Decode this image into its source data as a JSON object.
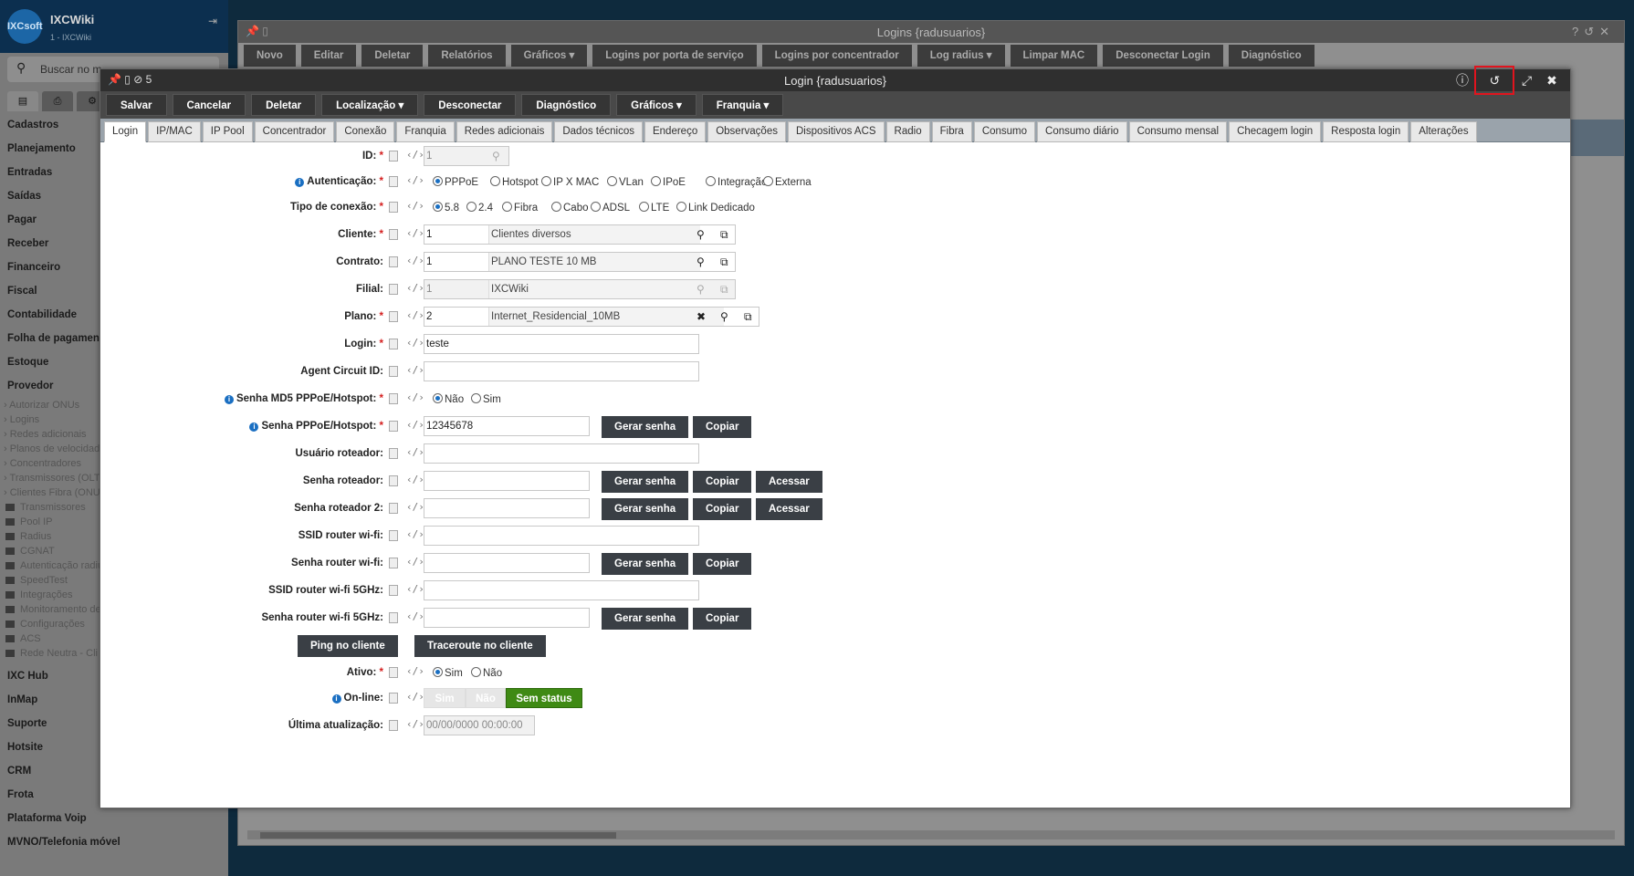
{
  "sidebar": {
    "logo": "IXCsoft",
    "app_name": "IXCWiki",
    "app_sub": "1 - IXCWiki",
    "search_placeholder": "Buscar no m",
    "menu_top": [
      "Cadastros",
      "Planejamento",
      "Entradas",
      "Saídas",
      "Pagar",
      "Receber",
      "Financeiro",
      "Fiscal",
      "Contabilidade",
      "Folha de pagamento",
      "Estoque",
      "Provedor"
    ],
    "submenu_arrows": [
      "Autorizar ONUs",
      "Logins",
      "Redes adicionais",
      "Planos de velocidade",
      "Concentradores",
      "Transmissores (OLT)",
      "Clientes Fibra (ONU)"
    ],
    "submenu_folders": [
      "Transmissores",
      "Pool IP",
      "Radius",
      "CGNAT",
      "Autenticação radius",
      "SpeedTest",
      "Integrações",
      "Monitoramento de",
      "Configurações",
      "ACS",
      "Rede Neutra - Cli"
    ],
    "menu_bottom": [
      "IXC Hub",
      "InMap",
      "Suporte",
      "Hotsite",
      "CRM",
      "Frota",
      "Plataforma Voip",
      "MVNO/Telefonia móvel"
    ]
  },
  "bgwin": {
    "title": "Logins {radusuarios}",
    "toolbar": [
      "Novo",
      "Editar",
      "Deletar",
      "Relatórios",
      "Gráficos ▾",
      "Logins por porta de serviço",
      "Logins por concentrador",
      "Log radius ▾",
      "Limpar MAC",
      "Desconectar Login",
      "Diagnóstico"
    ]
  },
  "modal": {
    "title": "Login {radusuarios}",
    "counter": "5",
    "toolbar": [
      "Salvar",
      "Cancelar",
      "Deletar",
      "Localização ▾",
      "Desconectar",
      "Diagnóstico",
      "Gráficos ▾",
      "Franquia ▾"
    ],
    "tabs": [
      "Login",
      "IP/MAC",
      "IP Pool",
      "Concentrador",
      "Conexão",
      "Franquia",
      "Redes adicionais",
      "Dados técnicos",
      "Endereço",
      "Observações",
      "Dispositivos ACS",
      "Radio",
      "Fibra",
      "Consumo",
      "Consumo diário",
      "Consumo mensal",
      "Checagem login",
      "Resposta login",
      "Alterações"
    ],
    "active_tab": "Login"
  },
  "form": {
    "id": {
      "label": "ID:",
      "value": "1"
    },
    "autenticacao": {
      "label": "Autenticação:",
      "options": [
        "PPPoE",
        "Hotspot",
        "IP X MAC",
        "VLan",
        "IPoE",
        "Integração",
        "Externa"
      ],
      "selected": "PPPoE"
    },
    "tipo_conexao": {
      "label": "Tipo de conexão:",
      "options": [
        "5.8",
        "2.4",
        "Fibra",
        "Cabo",
        "ADSL",
        "LTE",
        "Link Dedicado"
      ],
      "selected": "5.8"
    },
    "cliente": {
      "label": "Cliente:",
      "id": "1",
      "desc": "Clientes diversos"
    },
    "contrato": {
      "label": "Contrato:",
      "id": "1",
      "desc": "PLANO TESTE 10 MB"
    },
    "filial": {
      "label": "Filial:",
      "id": "1",
      "desc": "IXCWiki"
    },
    "plano": {
      "label": "Plano:",
      "id": "2",
      "desc": "Internet_Residencial_10MB"
    },
    "login": {
      "label": "Login:",
      "value": "teste"
    },
    "agent_circuit": {
      "label": "Agent Circuit ID:",
      "value": ""
    },
    "senha_md5": {
      "label": "Senha MD5 PPPoE/Hotspot:",
      "options": [
        "Não",
        "Sim"
      ],
      "selected": "Não"
    },
    "senha_pppoe": {
      "label": "Senha PPPoE/Hotspot:",
      "value": "12345678"
    },
    "usuario_roteador": {
      "label": "Usuário roteador:",
      "value": ""
    },
    "senha_roteador": {
      "label": "Senha roteador:",
      "value": ""
    },
    "senha_roteador2": {
      "label": "Senha roteador 2:",
      "value": ""
    },
    "ssid_wifi": {
      "label": "SSID router wi-fi:",
      "value": ""
    },
    "senha_wifi": {
      "label": "Senha router wi-fi:",
      "value": ""
    },
    "ssid_5g": {
      "label": "SSID router wi-fi 5GHz:",
      "value": ""
    },
    "senha_5g": {
      "label": "Senha router wi-fi 5GHz:",
      "value": ""
    },
    "ativo": {
      "label": "Ativo:",
      "options": [
        "Sim",
        "Não"
      ],
      "selected": "Sim"
    },
    "online": {
      "label": "On-line:",
      "options": [
        "Sim",
        "Não",
        "Sem status"
      ],
      "selected": "Sem status"
    },
    "ultima_atualizacao": {
      "label": "Última atualização:",
      "value": "00/00/0000 00:00:00"
    },
    "buttons": {
      "gerar": "Gerar senha",
      "copiar": "Copiar",
      "acessar": "Acessar",
      "ping": "Ping no cliente",
      "traceroute": "Traceroute no cliente"
    }
  },
  "colors": {
    "highlight": "#e0141e",
    "accent_blue": "#1a6fc2",
    "status_green": "#3f8a14"
  }
}
